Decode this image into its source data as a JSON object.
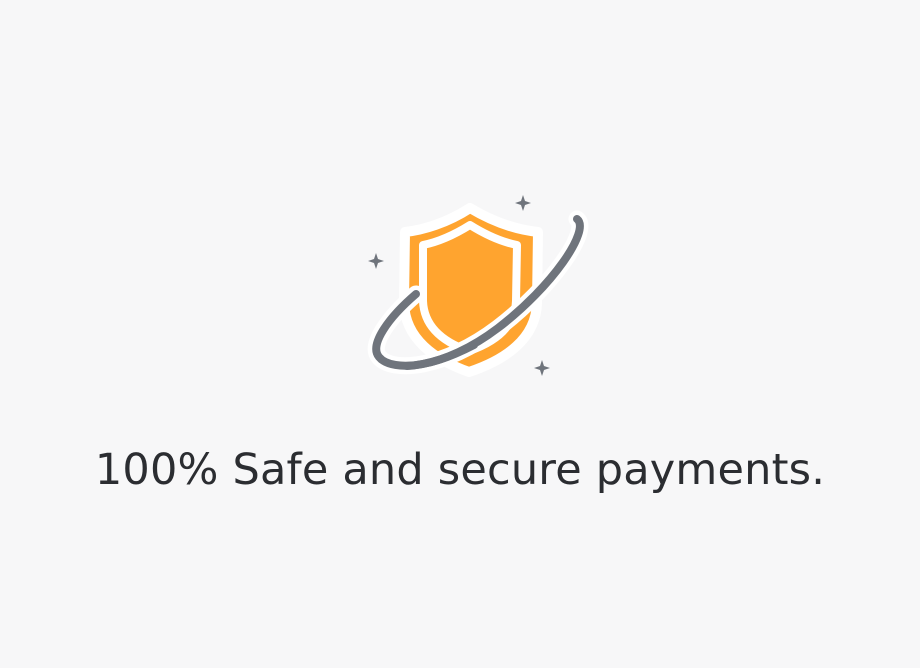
{
  "illustration": {
    "icon": "secure-shield-orbit-icon",
    "colors": {
      "shield": "#ffa42f",
      "shield_outline": "#ffffff",
      "orbit": "#6f747c",
      "sparkle": "#6f747c"
    }
  },
  "message": {
    "text": "100% Safe and secure payments."
  }
}
